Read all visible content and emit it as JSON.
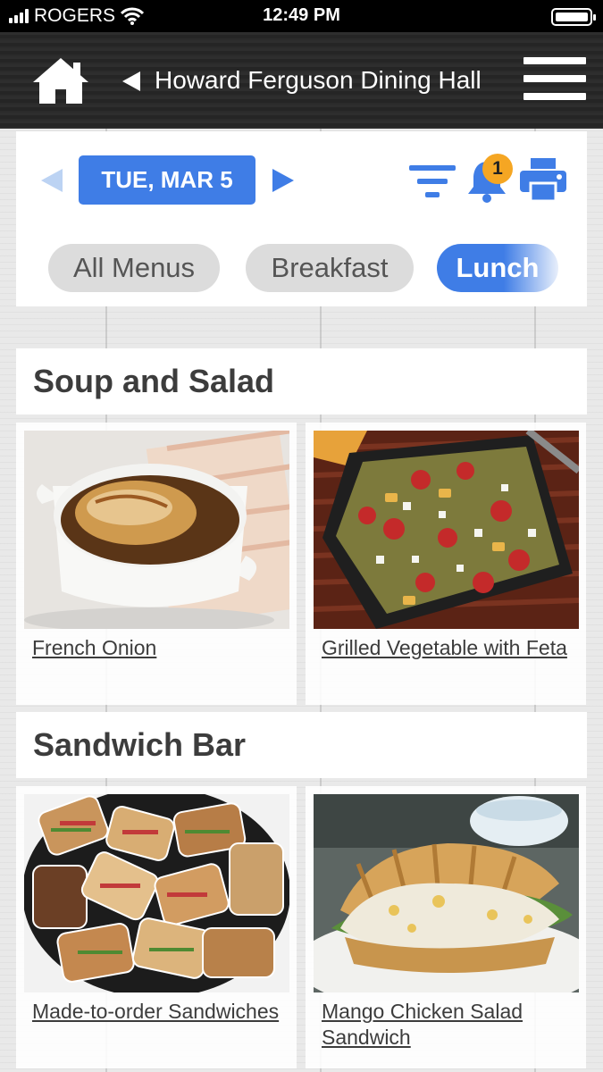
{
  "status_bar": {
    "carrier": "ROGERS",
    "time": "12:49 PM"
  },
  "header": {
    "title": "Howard Ferguson Dining Hall"
  },
  "date_bar": {
    "date": "TUE, MAR 5",
    "notification_count": "1"
  },
  "tabs": [
    {
      "label": "All Menus",
      "selected": false
    },
    {
      "label": "Breakfast",
      "selected": false
    },
    {
      "label": "Lunch",
      "selected": true
    }
  ],
  "sections": [
    {
      "title": "Soup and Salad",
      "items": [
        {
          "name": "French Onion",
          "image": "french-onion-soup-photo"
        },
        {
          "name": "Grilled Vegetable with Feta",
          "image": "grilled-vegetable-feta-photo"
        }
      ]
    },
    {
      "title": "Sandwich Bar",
      "items": [
        {
          "name": "Made-to-order Sandwiches",
          "image": "sandwich-platter-photo"
        },
        {
          "name": "Mango Chicken Salad Sandwich",
          "image": "chicken-salad-croissant-photo"
        }
      ]
    }
  ],
  "colors": {
    "accent": "#3f7de6",
    "badge": "#f5a623",
    "header_bg": "#2b2b2b"
  }
}
